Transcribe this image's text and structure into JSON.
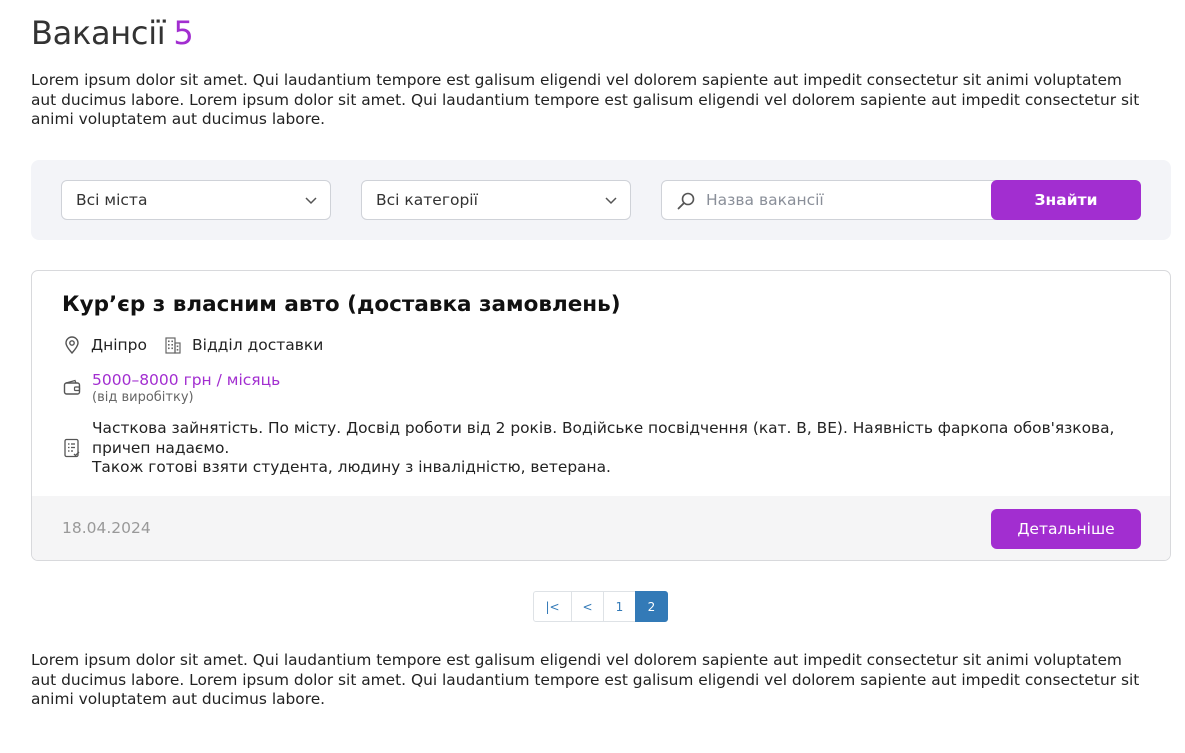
{
  "header": {
    "title": "Вакансії",
    "count": "5"
  },
  "intro_text": "Lorem ipsum dolor sit amet. Qui laudantium tempore est galisum eligendi vel dolorem sapiente aut impedit consectetur sit animi voluptatem aut ducimus labore. Lorem ipsum dolor sit amet. Qui laudantium tempore est galisum eligendi vel dolorem sapiente aut impedit consectetur sit animi voluptatem aut ducimus labore.",
  "filters": {
    "city_selected": "Всі міста",
    "category_selected": "Всі категорії",
    "search_placeholder": "Назва вакансії",
    "search_value": "",
    "search_button": "Знайти"
  },
  "vacancy": {
    "title": "Кур’єр з власним авто (доставка замовлень)",
    "city": "Дніпро",
    "department": "Відділ доставки",
    "salary": "5000–8000 грн / місяць",
    "salary_note": "(від виробітку)",
    "description": "Часткова зайнятість. По місту. Досвід роботи від 2 років. Водійське посвідчення (кат. B, BE). Наявність фаркопа обов'язкова, причеп надаємо.\nТакож готові взяти студента, людину з інвалідністю, ветерана.",
    "date": "18.04.2024",
    "details_button": "Детальніше"
  },
  "pagination": {
    "first": "|<",
    "prev": "<",
    "pages": [
      "1",
      "2"
    ],
    "active_page": "2"
  },
  "outro_text": "Lorem ipsum dolor sit amet. Qui laudantium tempore est galisum eligendi vel dolorem sapiente aut impedit consectetur sit animi voluptatem aut ducimus labore. Lorem ipsum dolor sit amet. Qui laudantium tempore est galisum eligendi vel dolorem sapiente aut impedit consectetur sit animi voluptatem aut ducimus labore.",
  "colors": {
    "accent": "#a22ed0",
    "pagination_active": "#337ab7",
    "filter_bg": "#f3f4f8"
  },
  "icons": {
    "city": "location-pin-icon",
    "department": "building-icon",
    "salary": "wallet-icon",
    "description": "clipboard-list-icon",
    "search": "search-icon",
    "dropdown": "chevron-down-icon"
  }
}
